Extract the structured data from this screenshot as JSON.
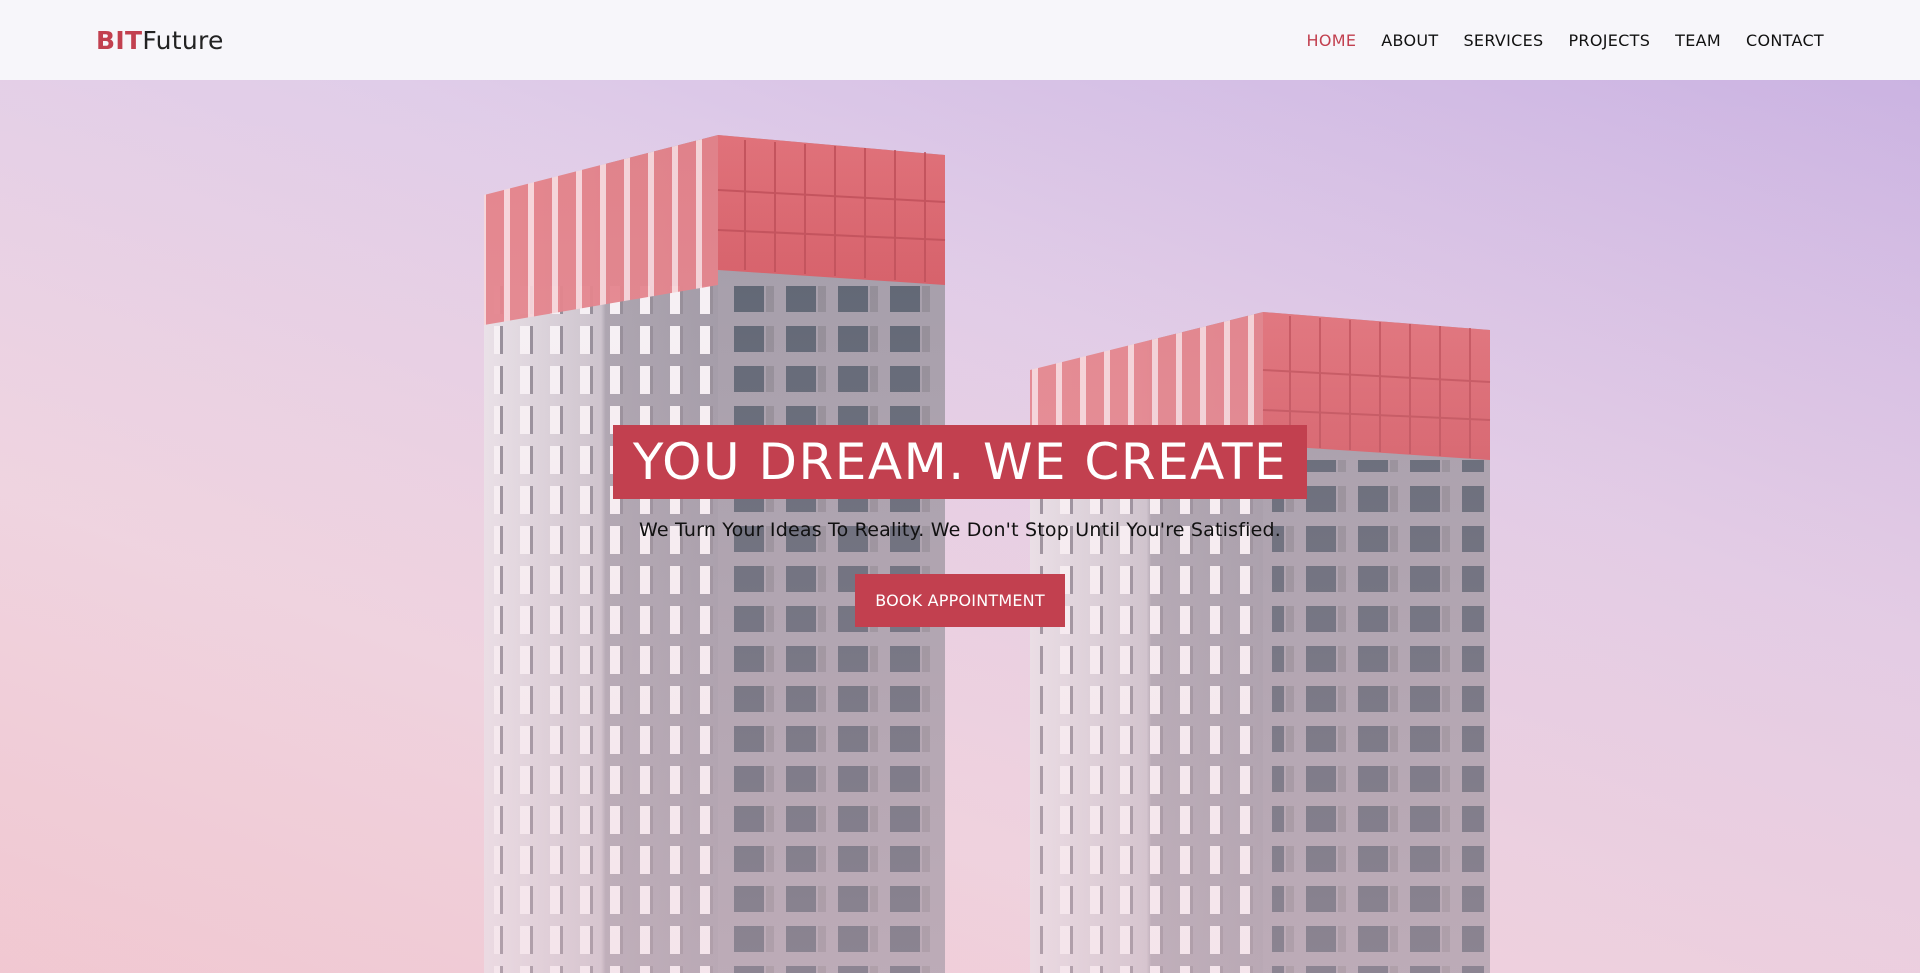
{
  "brand": {
    "part1": "BIT",
    "part2": "Future"
  },
  "nav": {
    "items": [
      {
        "label": "HOME",
        "active": true
      },
      {
        "label": "ABOUT",
        "active": false
      },
      {
        "label": "SERVICES",
        "active": false
      },
      {
        "label": "PROJECTS",
        "active": false
      },
      {
        "label": "TEAM",
        "active": false
      },
      {
        "label": "CONTACT",
        "active": false
      }
    ]
  },
  "hero": {
    "headline": "YOU DREAM. WE CREATE",
    "subline": "We Turn Your Ideas To Reality. We Don't Stop Until You're Satisfied.",
    "cta_label": "BOOK APPOINTMENT"
  },
  "colors": {
    "accent": "#c2404f",
    "nav_bg": "#f7f6fa",
    "text": "#111111"
  }
}
